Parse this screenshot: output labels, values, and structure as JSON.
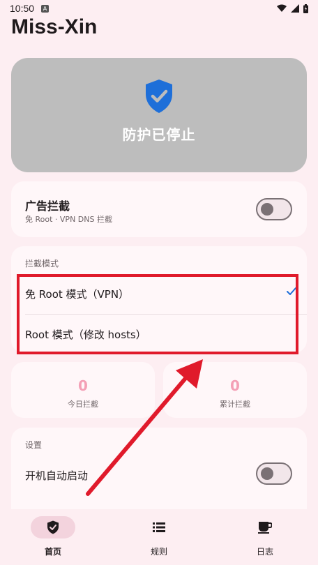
{
  "status_bar": {
    "time": "10:50",
    "notification_badge": "A"
  },
  "app": {
    "title": "Miss-Xin"
  },
  "hero": {
    "status_text": "防护已停止",
    "icon": "shield-check-icon",
    "color": "#bdbdbd"
  },
  "adblock": {
    "title": "广告拦截",
    "subtitle": "免 Root · VPN DNS 拦截",
    "enabled": false
  },
  "block_mode": {
    "section_label": "拦截模式",
    "options": [
      {
        "label": "免 Root 模式（VPN）",
        "selected": true
      },
      {
        "label": "Root 模式（修改 hosts）",
        "selected": false
      }
    ]
  },
  "stats": [
    {
      "value": "0",
      "label": "今日拦截"
    },
    {
      "value": "0",
      "label": "累计拦截"
    }
  ],
  "settings": {
    "section_label": "设置",
    "items": [
      {
        "label": "开机自动启动",
        "enabled": false
      }
    ]
  },
  "bottom_nav": {
    "items": [
      {
        "label": "首页",
        "icon": "shield-check-icon",
        "active": true
      },
      {
        "label": "规则",
        "icon": "list-icon",
        "active": false
      },
      {
        "label": "日志",
        "icon": "coffee-icon",
        "active": false
      }
    ]
  },
  "colors": {
    "accent": "#1e6fd9",
    "annotation": "#e01a2b",
    "stat_value": "#f4a0b6"
  }
}
